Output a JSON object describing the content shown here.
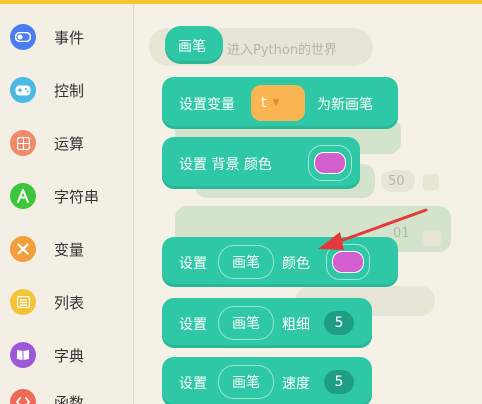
{
  "sidebar": {
    "items": [
      {
        "label": "事件",
        "icon": "toggle-icon",
        "color": "#4a7ef0"
      },
      {
        "label": "控制",
        "icon": "gamepad-icon",
        "color": "#4ab9e6"
      },
      {
        "label": "运算",
        "icon": "calculator-icon",
        "color": "#f08a6a"
      },
      {
        "label": "字符串",
        "icon": "letter-a-icon",
        "color": "#3cc63c"
      },
      {
        "label": "变量",
        "icon": "x-icon",
        "color": "#f29e3a"
      },
      {
        "label": "列表",
        "icon": "list-icon",
        "color": "#f2c43a"
      },
      {
        "label": "字典",
        "icon": "book-icon",
        "color": "#9b59d8"
      },
      {
        "label": "函数",
        "icon": "code-icon",
        "color": "#f06a5a"
      }
    ]
  },
  "workspace": {
    "ghost_text": "进入Python的世界",
    "ghost_num_a": "50",
    "ghost_num_b": "01",
    "blocks": {
      "pen_hat": "画笔",
      "set_var_prefix": "设置变量",
      "set_var_value": "t",
      "set_var_suffix": "为新画笔",
      "set_bg_label": "设置 背景 颜色",
      "set_bg_color": "#d35fce",
      "set_color_prefix": "设置",
      "set_color_target": "画笔",
      "set_color_suffix": "颜色",
      "set_color_value": "#d35fce",
      "set_size_prefix": "设置",
      "set_size_target": "画笔",
      "set_size_suffix": "粗细",
      "set_size_value": "5",
      "set_speed_prefix": "设置",
      "set_speed_target": "画笔",
      "set_speed_suffix": "速度",
      "set_speed_value": "5"
    }
  },
  "colors": {
    "block_green": "#2ec8a6",
    "arrow_red": "#e23a3a",
    "top_strip": "#f7c531"
  }
}
